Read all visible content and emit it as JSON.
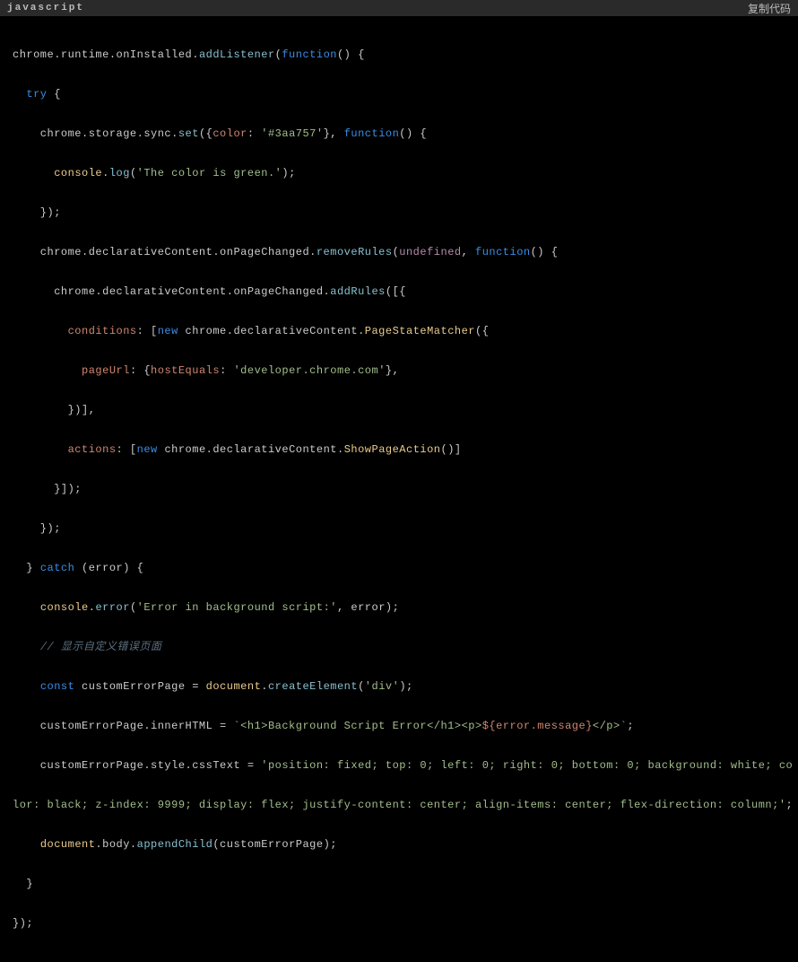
{
  "header": {
    "language": "javascript",
    "copy_label": "复制代码"
  },
  "code": {
    "l1_a": "chrome.runtime.onInstalled.",
    "l1_b": "addListener",
    "l1_c": "(",
    "l1_d": "function",
    "l1_e": "() {",
    "l2_a": "  ",
    "l2_b": "try",
    "l2_c": " {",
    "l3_a": "    chrome.storage.sync.",
    "l3_b": "set",
    "l3_c": "({",
    "l3_d": "color",
    "l3_e": ": ",
    "l3_f": "'#3aa757'",
    "l3_g": "}, ",
    "l3_h": "function",
    "l3_i": "() {",
    "l4_a": "      ",
    "l4_b": "console",
    "l4_c": ".",
    "l4_d": "log",
    "l4_e": "(",
    "l4_f": "'The color is green.'",
    "l4_g": ");",
    "l5_a": "    });",
    "l6_a": "    chrome.declarativeContent.onPageChanged.",
    "l6_b": "removeRules",
    "l6_c": "(",
    "l6_d": "undefined",
    "l6_e": ", ",
    "l6_f": "function",
    "l6_g": "() {",
    "l7_a": "      chrome.declarativeContent.onPageChanged.",
    "l7_b": "addRules",
    "l7_c": "([{",
    "l8_a": "        ",
    "l8_b": "conditions",
    "l8_c": ": [",
    "l8_d": "new",
    "l8_e": " chrome.declarativeContent.",
    "l8_f": "PageStateMatcher",
    "l8_g": "({",
    "l9_a": "          ",
    "l9_b": "pageUrl",
    "l9_c": ": {",
    "l9_d": "hostEquals",
    "l9_e": ": ",
    "l9_f": "'developer.chrome.com'",
    "l9_g": "},",
    "l10_a": "        })],",
    "l11_a": "        ",
    "l11_b": "actions",
    "l11_c": ": [",
    "l11_d": "new",
    "l11_e": " chrome.declarativeContent.",
    "l11_f": "ShowPageAction",
    "l11_g": "()]",
    "l12_a": "      }]);",
    "l13_a": "    });",
    "l14_a": "  } ",
    "l14_b": "catch",
    "l14_c": " (error) {",
    "l15_a": "    ",
    "l15_b": "console",
    "l15_c": ".",
    "l15_d": "error",
    "l15_e": "(",
    "l15_f": "'Error in background script:'",
    "l15_g": ", error);",
    "l16_a": "    ",
    "l16_b": "// 显示自定义错误页面",
    "l17_a": "    ",
    "l17_b": "const",
    "l17_c": " customErrorPage = ",
    "l17_d": "document",
    "l17_e": ".",
    "l17_f": "createElement",
    "l17_g": "(",
    "l17_h": "'div'",
    "l17_i": ");",
    "l18_a": "    customErrorPage.innerHTML = ",
    "l18_b": "`<h1>Background Script Error</h1><p>",
    "l18_c": "${error.message}",
    "l18_d": "</p>`",
    "l18_e": ";",
    "l19_a": "    customErrorPage.style.cssText = ",
    "l19_b": "'position: fixed; top: 0; left: 0; right: 0; bottom: 0; background: white; co",
    "l20_a": "lor: black; z-index: 9999; display: flex; justify-content: center; align-items: center; flex-direction: column;'",
    "l20_b": ";",
    "l21_a": "    ",
    "l21_b": "document",
    "l21_c": ".body.",
    "l21_d": "appendChild",
    "l21_e": "(customErrorPage);",
    "l22_a": "  }",
    "l23_a": "});"
  }
}
